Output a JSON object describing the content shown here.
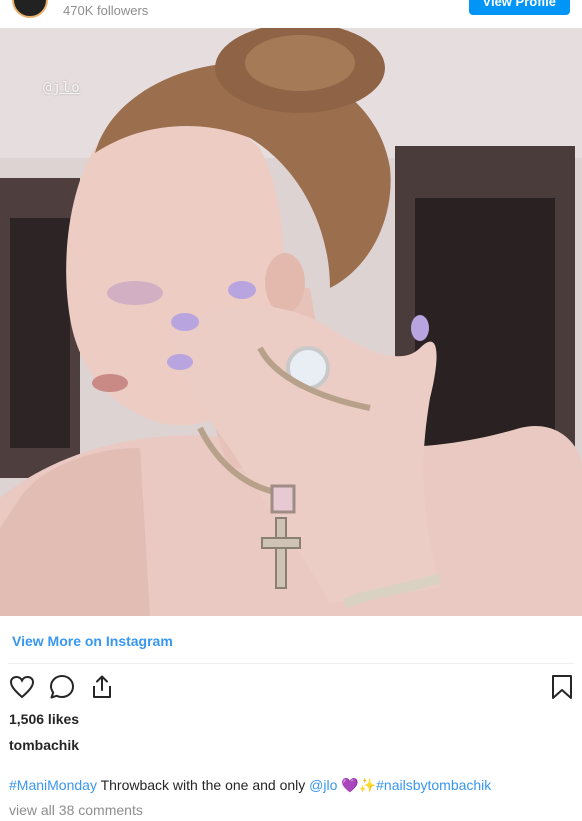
{
  "header": {
    "followers": "470K followers",
    "view_profile_label": "View Profile"
  },
  "post": {
    "watermark": "@jlo",
    "view_more_label": "View More on Instagram",
    "likes": "1,506 likes",
    "username": "tombachik",
    "caption": {
      "hashtag1": "#ManiMonday",
      "text": " Throwback with the one and only ",
      "mention": "@jlo",
      "emoji1": "💜",
      "emoji2": "✨",
      "hashtag2": "#nailsbytombachik"
    },
    "comments_label": "view all 38 comments"
  },
  "icons": [
    "heart-icon",
    "comment-icon",
    "share-icon",
    "bookmark-icon"
  ],
  "colors": {
    "link": "#3897f0",
    "button": "#0095f6",
    "muted": "#8e8e8e"
  }
}
